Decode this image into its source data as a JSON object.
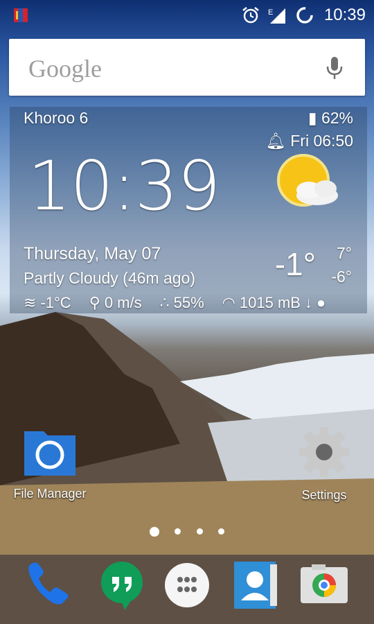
{
  "status_bar": {
    "time": "10:39",
    "network_label": "E",
    "icons": [
      "flag-icon",
      "alarm-icon",
      "signal-icon",
      "loading-circle-icon"
    ]
  },
  "search": {
    "logo": "Google",
    "mic_icon": "mic-icon"
  },
  "weather": {
    "location": "Khoroo 6",
    "battery": "62%",
    "alarm": "Fri 06:50",
    "time": "10:39",
    "date": "Thursday, May 07",
    "condition": "Partly Cloudy  (46m ago)",
    "temp_now": "-1°",
    "temp_high": "7°",
    "temp_low": "-6°",
    "feels_like": "-1°C",
    "wind": "0 m/s",
    "humidity": "55%",
    "pressure": "1015 mB",
    "icons": [
      "partly-cloudy-icon",
      "wind-icon",
      "humidity-icon",
      "pressure-icon",
      "moon-icon"
    ]
  },
  "apps": {
    "file_manager": "File Manager",
    "settings": "Settings"
  },
  "pager": {
    "pages": 4,
    "current": 1
  },
  "dock": {
    "items": [
      "phone-icon",
      "hangouts-icon",
      "app-drawer-icon",
      "contacts-icon",
      "camera-icon"
    ]
  }
}
